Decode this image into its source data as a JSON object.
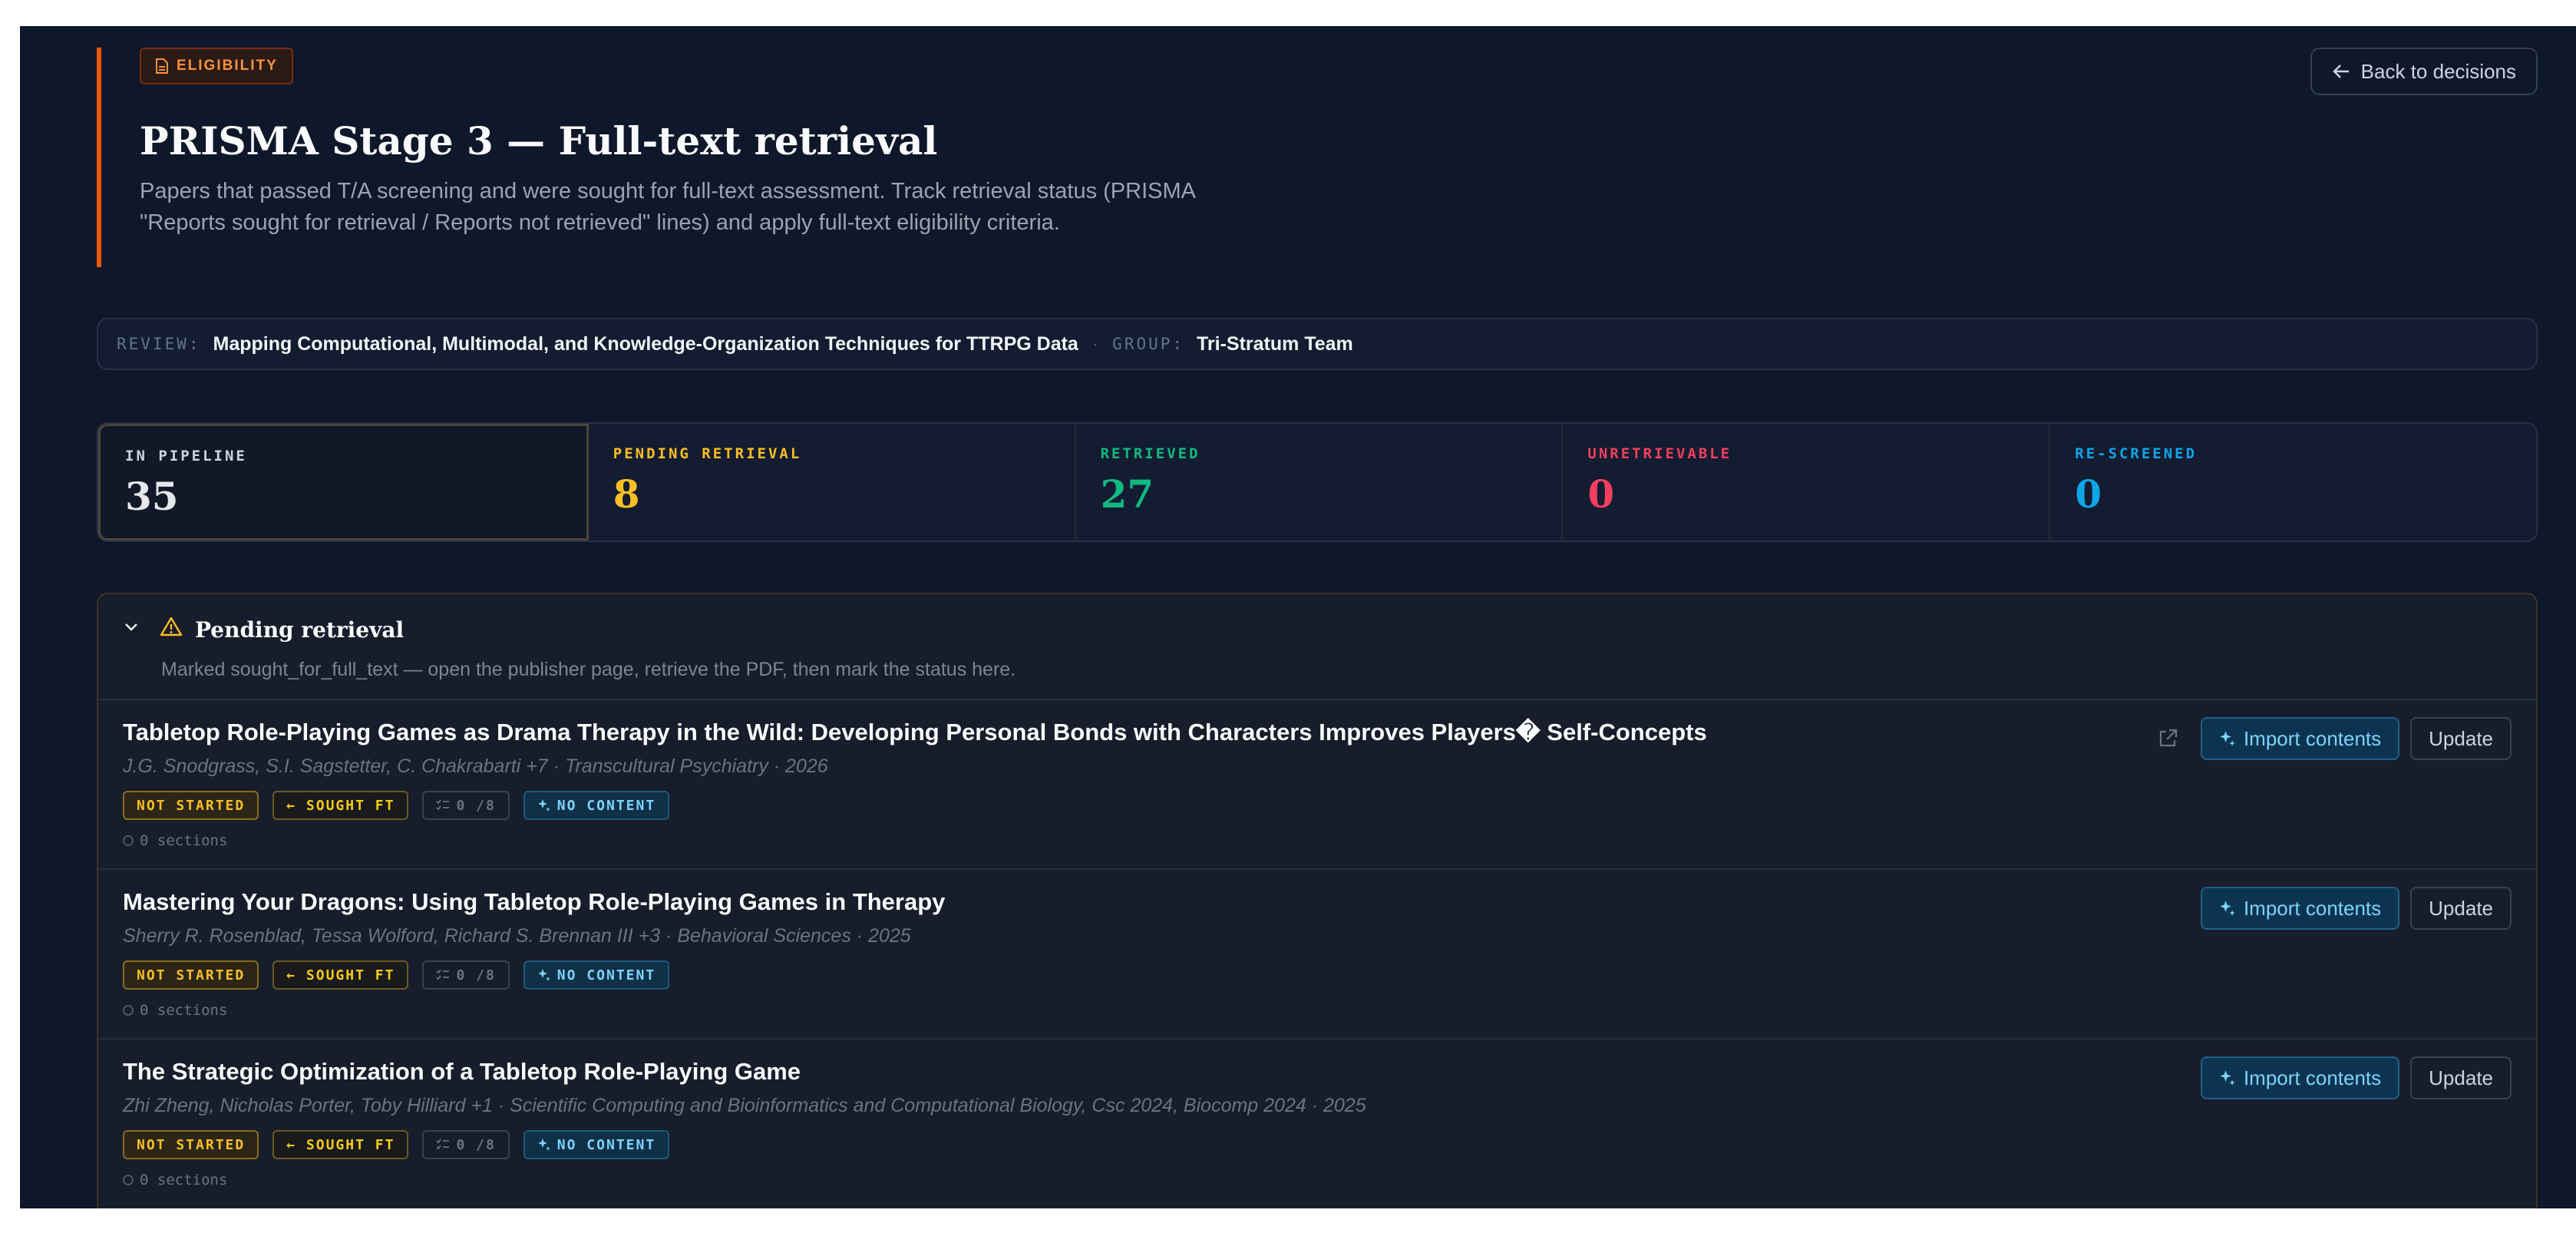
{
  "header": {
    "badge": "ELIGIBILITY",
    "title": "PRISMA Stage 3 — Full-text retrieval",
    "description": "Papers that passed T/A screening and were sought for full-text assessment. Track retrieval status (PRISMA \"Reports sought for retrieval / Reports not retrieved\" lines) and apply full-text eligibility criteria.",
    "back_label": "Back to decisions"
  },
  "review_bar": {
    "review_label": "REVIEW:",
    "review_value": "Mapping Computational, Multimodal, and Knowledge-Organization Techniques for TTRPG Data",
    "separator": "·",
    "group_label": "GROUP:",
    "group_value": "Tri-Stratum Team"
  },
  "stats": [
    {
      "label": "IN PIPELINE",
      "value": "35",
      "color": "#e5e7eb"
    },
    {
      "label": "PENDING RETRIEVAL",
      "value": "8",
      "color": "#fbbf24"
    },
    {
      "label": "RETRIEVED",
      "value": "27",
      "color": "#10b981"
    },
    {
      "label": "UNRETRIEVABLE",
      "value": "0",
      "color": "#f43f5e"
    },
    {
      "label": "RE-SCREENED",
      "value": "0",
      "color": "#0ea5e9"
    }
  ],
  "pending": {
    "title": "Pending retrieval",
    "subtitle": "Marked sought_for_full_text — open the publisher page, retrieve the PDF, then mark the status here.",
    "rows": [
      {
        "title": "Tabletop Role-Playing Games as Drama Therapy in the Wild: Developing Personal Bonds with Characters Improves Players� Self-Concepts",
        "meta": "J.G. Snodgrass, S.I. Sagstetter, C. Chakrabarti +7 · Transcultural Psychiatry · 2026",
        "chip_status": "NOT STARTED",
        "chip_sought": "← SOUGHT FT",
        "chip_count": "0 /8",
        "chip_content": "NO CONTENT",
        "sections": "0 sections",
        "import_label": "Import contents",
        "update_label": "Update"
      },
      {
        "title": "Mastering Your Dragons: Using Tabletop Role-Playing Games in Therapy",
        "meta": "Sherry R. Rosenblad, Tessa Wolford, Richard S. Brennan III +3 · Behavioral Sciences · 2025",
        "chip_status": "NOT STARTED",
        "chip_sought": "← SOUGHT FT",
        "chip_count": "0 /8",
        "chip_content": "NO CONTENT",
        "sections": "0 sections",
        "import_label": "Import contents",
        "update_label": "Update"
      },
      {
        "title": "The Strategic Optimization of a Tabletop Role-Playing Game",
        "meta": "Zhi Zheng, Nicholas Porter, Toby Hilliard +1 · Scientific Computing and Bioinformatics and Computational Biology, Csc 2024, Biocomp 2024 · 2025",
        "chip_status": "NOT STARTED",
        "chip_sought": "← SOUGHT FT",
        "chip_count": "0 /8",
        "chip_content": "NO CONTENT",
        "sections": "0 sections",
        "import_label": "Import contents",
        "update_label": "Update"
      }
    ]
  }
}
